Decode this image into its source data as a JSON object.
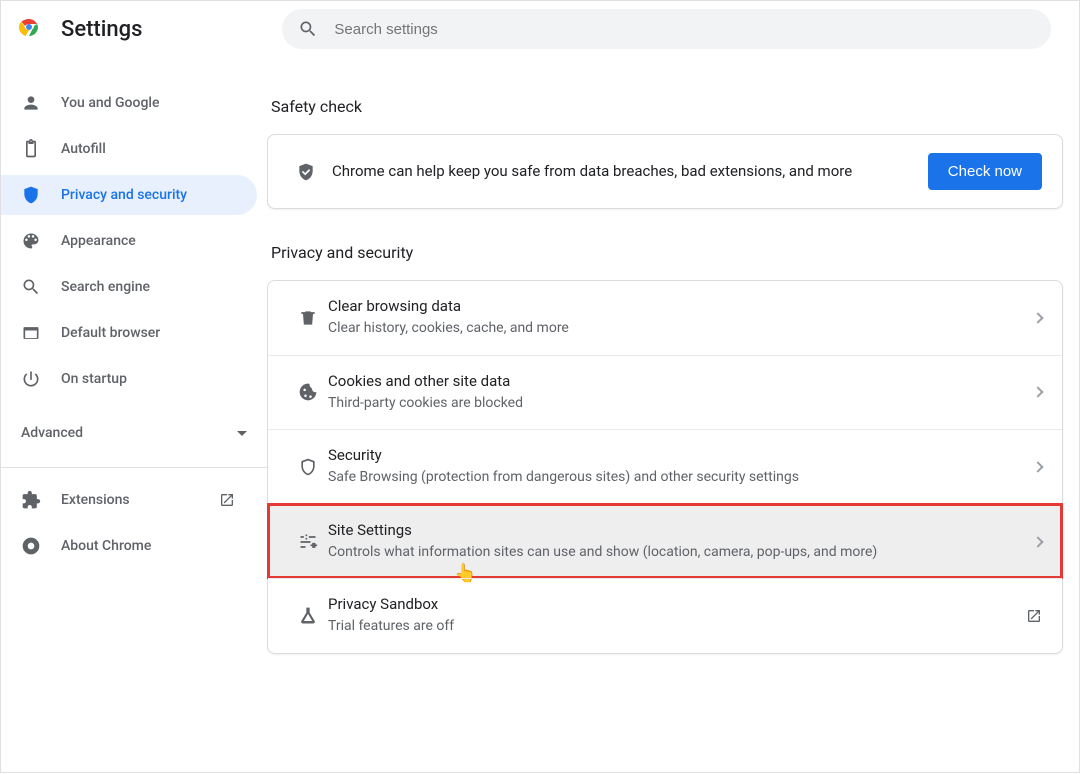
{
  "header": {
    "title": "Settings",
    "search_placeholder": "Search settings"
  },
  "sidebar": {
    "items": [
      {
        "label": "You and Google"
      },
      {
        "label": "Autofill"
      },
      {
        "label": "Privacy and security"
      },
      {
        "label": "Appearance"
      },
      {
        "label": "Search engine"
      },
      {
        "label": "Default browser"
      },
      {
        "label": "On startup"
      }
    ],
    "advanced_label": "Advanced",
    "footer": [
      {
        "label": "Extensions"
      },
      {
        "label": "About Chrome"
      }
    ]
  },
  "main": {
    "safety_check_title": "Safety check",
    "safety_check_text": "Chrome can help keep you safe from data breaches, bad extensions, and more",
    "check_now_label": "Check now",
    "privacy_title": "Privacy and security",
    "rows": [
      {
        "title": "Clear browsing data",
        "sub": "Clear history, cookies, cache, and more"
      },
      {
        "title": "Cookies and other site data",
        "sub": "Third-party cookies are blocked"
      },
      {
        "title": "Security",
        "sub": "Safe Browsing (protection from dangerous sites) and other security settings"
      },
      {
        "title": "Site Settings",
        "sub": "Controls what information sites can use and show (location, camera, pop-ups, and more)"
      },
      {
        "title": "Privacy Sandbox",
        "sub": "Trial features are off"
      }
    ]
  }
}
